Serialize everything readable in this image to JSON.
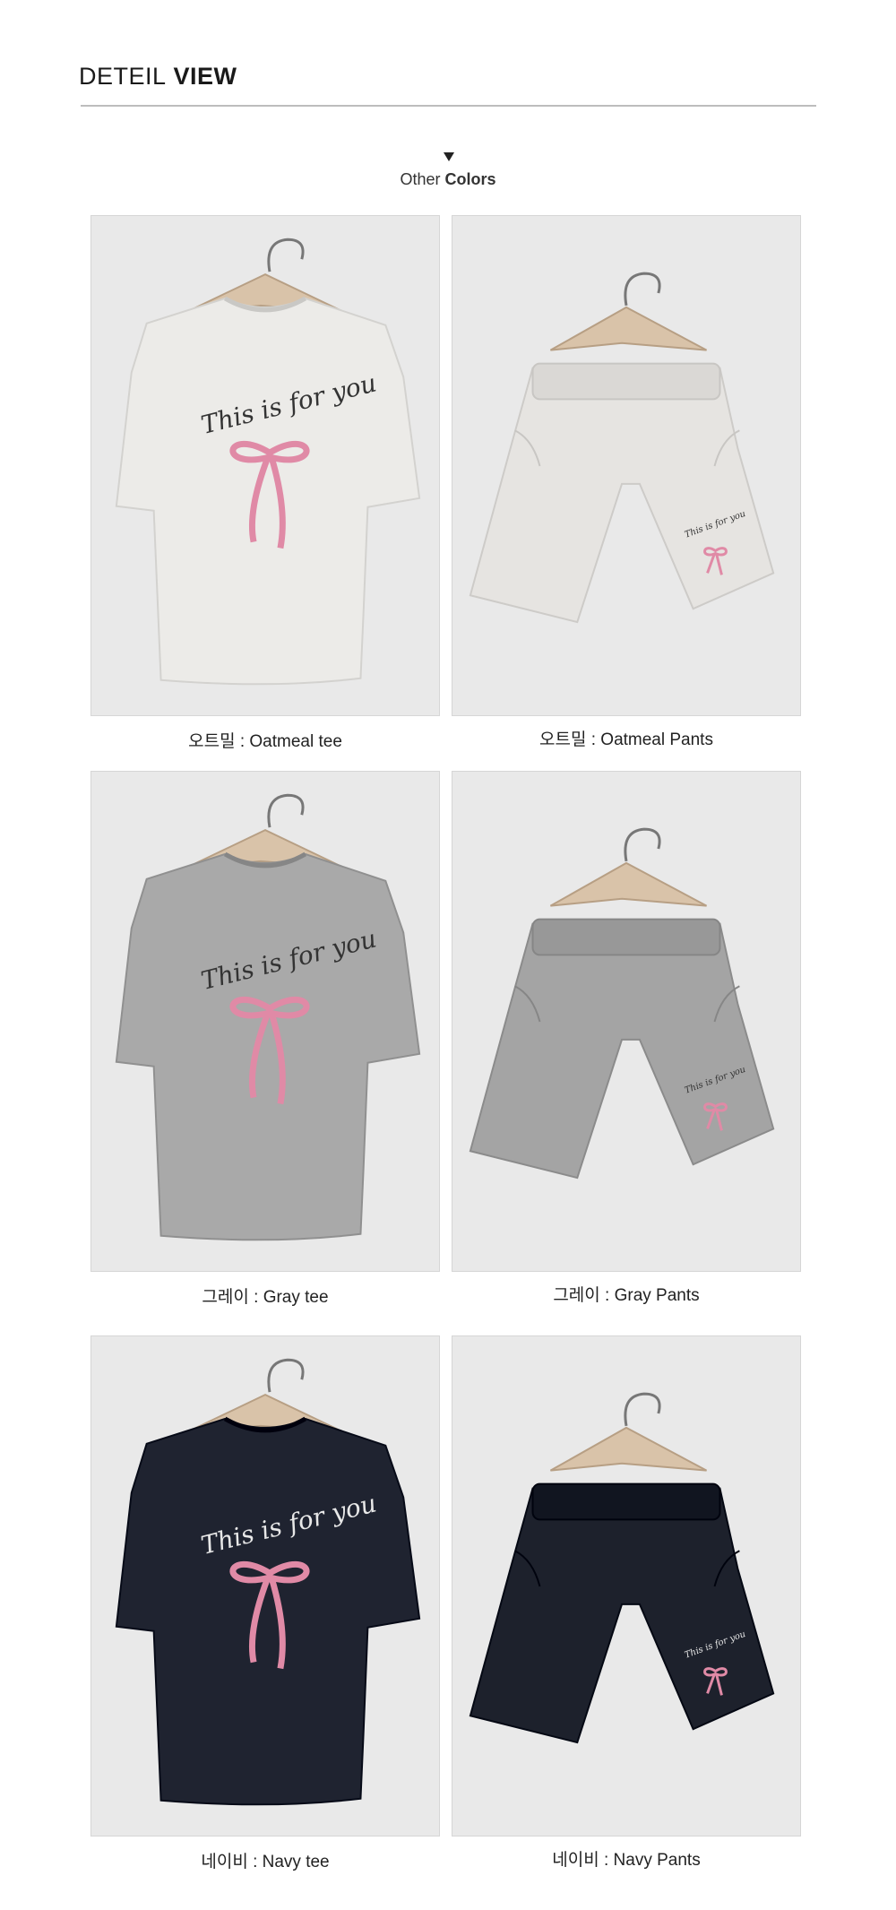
{
  "header": {
    "title_light": "DETEIL",
    "title_bold": "VIEW"
  },
  "section": {
    "subtitle_light": "Other",
    "subtitle_bold": "Colors",
    "arrow_icon": "triangle-down-icon"
  },
  "items": [
    {
      "caption": "오트밀 : Oatmeal tee",
      "garment": "tee",
      "color": "#ecebe8",
      "print": "This is for you"
    },
    {
      "caption": "오트밀 : Oatmeal Pants",
      "garment": "shorts",
      "color": "#e6e4e1",
      "print": "This is for you"
    },
    {
      "caption": "그레이 : Gray tee",
      "garment": "tee",
      "color": "#a9a9a9",
      "print": "This is for you"
    },
    {
      "caption": "그레이 : Gray Pants",
      "garment": "shorts",
      "color": "#a4a4a4",
      "print": "This is for you"
    },
    {
      "caption": "네이비 : Navy tee",
      "garment": "tee",
      "color": "#1f2330",
      "print": "This is for you"
    },
    {
      "caption": "네이비 : Navy Pants",
      "garment": "shorts",
      "color": "#1d212c",
      "print": "This is for you"
    }
  ],
  "colors": {
    "background": "#ffffff",
    "photo_background": "#e9e9e9",
    "ribbon": "#e08aa6",
    "rule": "#bdbdbd"
  }
}
